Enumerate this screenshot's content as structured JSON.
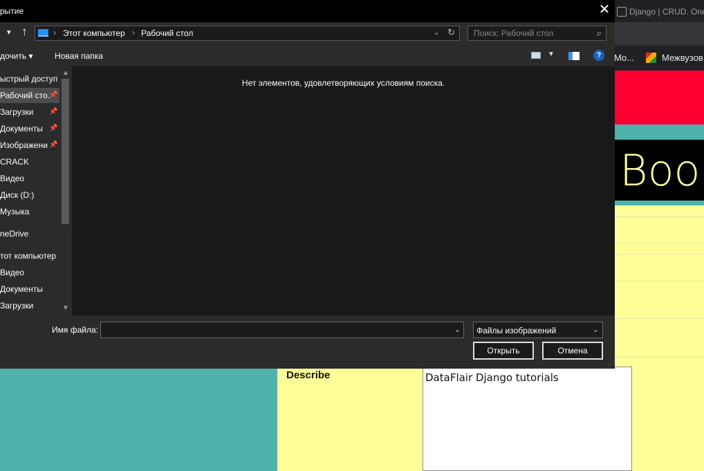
{
  "browser": {
    "tab_title": "Django | CRUD. One",
    "bookmarks": [
      "Mo...",
      "Межвузов"
    ],
    "hero_text": "Boo"
  },
  "page_form": {
    "describe_label": "Describe",
    "describe_value": "DataFlair Django tutorials"
  },
  "dialog": {
    "title": "рытие",
    "close_glyph": "✕",
    "address": {
      "crumbs": [
        "Этот компьютер",
        "Рабочий стол"
      ]
    },
    "search_placeholder": "Поиск: Рабочий стол",
    "toolbar": {
      "organize": "дочить ▾",
      "new_folder": "Новая папка",
      "help": "?"
    },
    "nav_items": [
      {
        "label": "ыстрый доступ",
        "pinned": false
      },
      {
        "label": "Рабочий сто.",
        "pinned": true,
        "selected": true
      },
      {
        "label": "Загрузки",
        "pinned": true
      },
      {
        "label": "Документы",
        "pinned": true
      },
      {
        "label": "Изображени",
        "pinned": true
      },
      {
        "label": "CRACK",
        "pinned": false
      },
      {
        "label": "Видео",
        "pinned": false
      },
      {
        "label": "Диск (D:)",
        "pinned": false
      },
      {
        "label": "Музыка",
        "pinned": false
      },
      {
        "label": "neDrive",
        "pinned": false
      },
      {
        "label": "тот компьютер",
        "pinned": false
      },
      {
        "label": "Видео",
        "pinned": false
      },
      {
        "label": "Документы",
        "pinned": false
      },
      {
        "label": "Загрузки",
        "pinned": false
      }
    ],
    "empty_message": "Нет элементов, удовлетворяющих условиям поиска.",
    "filename_label": "Имя файла:",
    "filename_value": "",
    "filetype": "Файлы изображений",
    "open_button": "Открыть",
    "cancel_button": "Отмена"
  }
}
